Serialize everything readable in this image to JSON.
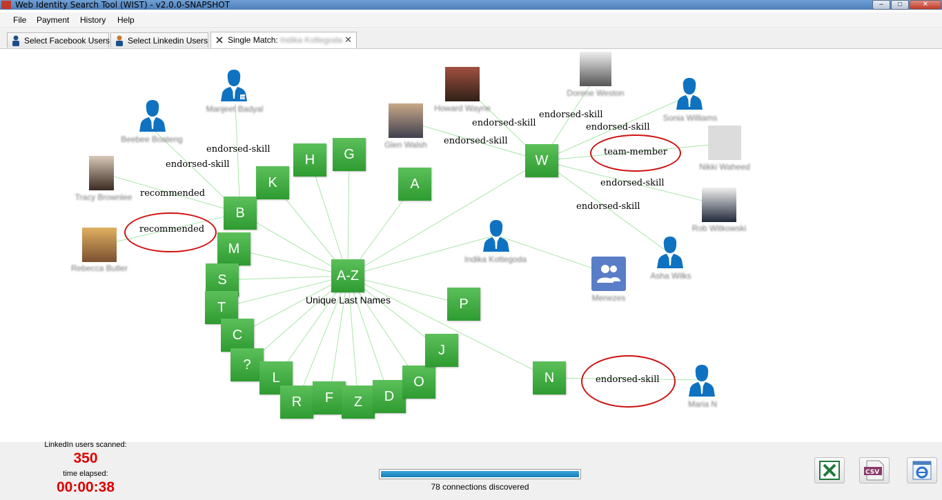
{
  "window": {
    "title": "Web Identity Search Tool (WIST) - v2.0.0-SNAPSHOT"
  },
  "menu": [
    "File",
    "Payment",
    "History",
    "Help"
  ],
  "tabs": [
    {
      "label": "Select Facebook Users",
      "icon": "person-icon"
    },
    {
      "label": "Select Linkedin Users",
      "icon": "person-icon"
    },
    {
      "label": "Single Match:",
      "extra": "Indika Kottegoda",
      "icon": "graph-icon",
      "active": true
    }
  ],
  "graph": {
    "hub": {
      "letter": "A-Z",
      "label": "Unique Last Names"
    },
    "letters": [
      "H",
      "G",
      "K",
      "A",
      "B",
      "M",
      "S",
      "T",
      "C",
      "?",
      "L",
      "R",
      "F",
      "Z",
      "D",
      "O",
      "J",
      "P",
      "N",
      "W"
    ],
    "people": [
      "Manjeet Badyal",
      "Beebee Boateng",
      "Tracy Brownlee",
      "Rebecca Butler",
      "Howard Wayne",
      "Glen Walsh",
      "Dorene Weston",
      "Sonia Williams",
      "Nikki Waheed",
      "Rob Witkowski",
      "Asha Wilks",
      "Indika Kottegoda",
      "Menezes",
      "Maria N"
    ],
    "edge_labels": {
      "b_manjeet": "endorsed-skill",
      "b_beebee": "endorsed-skill",
      "b_tracy": "recommended",
      "b_rebecca": "recommended",
      "w_howard": "endorsed-skill",
      "w_glen": "endorsed-skill",
      "w_dorene": "endorsed-skill",
      "w_sonia": "endorsed-skill",
      "w_nikki": "team-member",
      "w_rob": "endorsed-skill",
      "w_asha": "endorsed-skill",
      "n_maria": "endorsed-skill"
    }
  },
  "footer": {
    "scanned_label": "LinkedIn users scanned:",
    "scanned_value": "350",
    "elapsed_label": "time elapsed:",
    "elapsed_value": "00:00:38",
    "progress_fraction": 1.0,
    "progress_text": "78 connections discovered",
    "export_buttons": [
      "excel-export-icon",
      "csv-export-icon",
      "ie-export-icon"
    ]
  },
  "colors": {
    "node_green": "#3aab3a",
    "highlight_red": "#d01010",
    "value_red": "#e00000",
    "edge_green": "#9be39b"
  }
}
